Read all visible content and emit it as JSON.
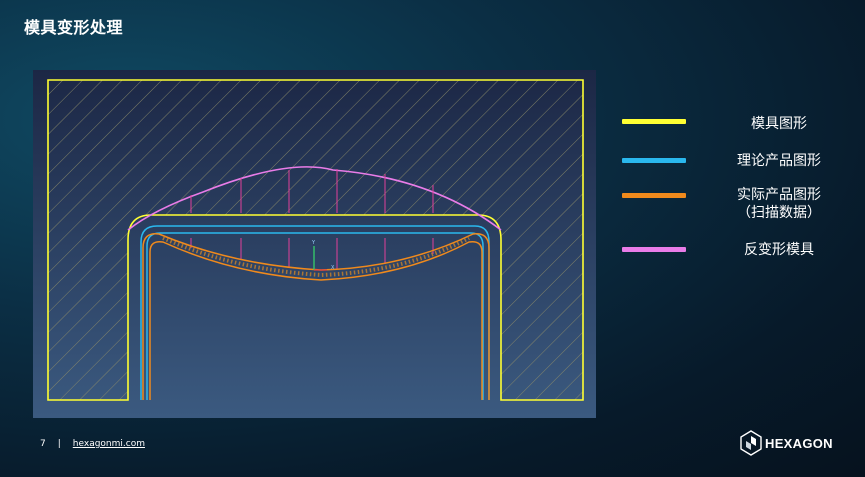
{
  "slide": {
    "title": "模具变形处理",
    "page_number": "7",
    "separator": "|",
    "website": "hexagonmi.com",
    "brand": "HEXAGON"
  },
  "legend": {
    "items": [
      {
        "label": "模具图形",
        "color": "#ffff33"
      },
      {
        "label": "理论产品图形",
        "color": "#2ab8ee"
      },
      {
        "label": "实际产品图形\n（扫描数据）",
        "color": "#f08a1c"
      },
      {
        "label": "反变形模具",
        "color": "#e97ce8"
      }
    ]
  },
  "figure": {
    "axis_labels": {
      "y": "Y",
      "x": "X"
    },
    "colors": {
      "background_top": "#1c2745",
      "background_bottom": "#3b5a80",
      "hatch": "#8a8a6a",
      "arrow": "#e0409a"
    }
  }
}
